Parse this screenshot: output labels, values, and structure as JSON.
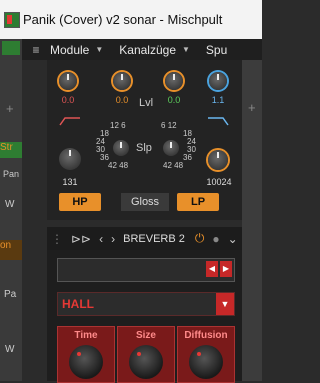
{
  "window": {
    "title": "Panik (Cover) v2 sonar - Mischpult"
  },
  "menu": {
    "items": [
      "Module",
      "Kanalzüge",
      "Spu"
    ]
  },
  "left_strip": {
    "labels": [
      "Str",
      "on",
      "Pa",
      "W",
      "Pan",
      "W"
    ]
  },
  "eq": {
    "knob_values": [
      "0.0",
      "0.0",
      "0.0",
      "1.1"
    ],
    "lvl_label": "Lvl",
    "slope_label": "Slp",
    "slope_ticks_left": [
      "12",
      "6",
      "18",
      "24",
      "30",
      "36",
      "42",
      "48"
    ],
    "slope_ticks_right": [
      "6",
      "12",
      "18",
      "24",
      "30",
      "36",
      "42",
      "48"
    ],
    "hp_freq": "131",
    "lp_freq": "10024",
    "hp_label": "HP",
    "gloss_label": "Gloss",
    "lp_label": "LP"
  },
  "plugin": {
    "name": "BREVERB 2"
  },
  "reverb": {
    "type": "HALL",
    "params": [
      "Time",
      "Size",
      "Diffusion"
    ]
  },
  "colors": {
    "accent": "#e8902a",
    "reverb_red": "#c62828"
  }
}
